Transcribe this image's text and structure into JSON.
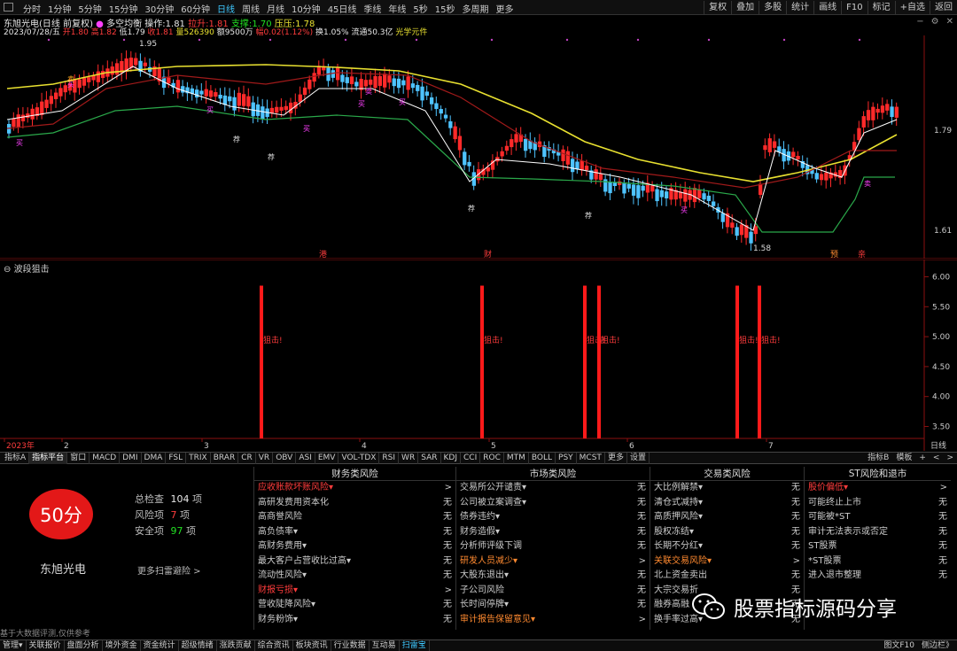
{
  "topbar": {
    "periods": [
      "分时",
      "1分钟",
      "5分钟",
      "15分钟",
      "30分钟",
      "60分钟",
      "日线",
      "周线",
      "月线",
      "10分钟",
      "45日线",
      "季线",
      "年线",
      "5秒",
      "15秒",
      "多周期",
      "更多"
    ],
    "active_period": "日线",
    "tools": [
      "复权",
      "叠加",
      "多股",
      "统计",
      "画线",
      "F10",
      "标记",
      "+自选",
      "返回"
    ]
  },
  "stock": {
    "title": "东旭光电(日线 前复权)",
    "indicator_name": "多空均衡",
    "op_label": "操作:",
    "op_value": "1.81",
    "pull_label": "拉升:",
    "pull_value": "1.81",
    "support_label": "支撑:",
    "support_value": "1.70",
    "pressure_label": "压压:",
    "pressure_value": "1.78",
    "date": "2023/07/28/五",
    "open": "开1.80",
    "high": "高1.82",
    "low": "低1.79",
    "close": "收1.81",
    "volume": "量526390",
    "amount": "额9500万",
    "change": "幅0.02(1.12%)",
    "turnover": "换1.05%",
    "float_cap": "流通50.3亿",
    "concept": "光学元件"
  },
  "main_chart": {
    "price_labels": [
      "1.79",
      "1.61"
    ],
    "high_marker": "1.95",
    "low_marker": "1.58",
    "signal_buy": "买",
    "signal_sell": "卖",
    "signal_recommend": "荐",
    "event_labels": [
      "港",
      "财",
      "预",
      "亲"
    ]
  },
  "chart_data": {
    "type": "bar",
    "title": "波段狙击",
    "ylabel": "",
    "ylim": [
      3.3,
      6.2
    ],
    "y_ticks": [
      "6.00",
      "5.50",
      "5.00",
      "4.50",
      "4.00",
      "3.50"
    ],
    "bar_label": "狙击!",
    "bar_count": 6,
    "bar_value": 6.0,
    "x_ticks": [
      "2023年",
      "2",
      "3",
      "4",
      "5",
      "6",
      "7"
    ],
    "x_period": "日线"
  },
  "indicator_bar": {
    "tabs": [
      "指标A",
      "指标平台",
      "窗口",
      "MACD",
      "DMI",
      "DMA",
      "FSL",
      "TRIX",
      "BRAR",
      "CR",
      "VR",
      "OBV",
      "ASI",
      "EMV",
      "VOL-TDX",
      "RSI",
      "WR",
      "SAR",
      "KDJ",
      "CCI",
      "ROC",
      "MTM",
      "BOLL",
      "PSY",
      "MCST",
      "更多",
      "设置"
    ],
    "active_tab": "指标平台",
    "right": [
      "指标B",
      "模板",
      "+",
      "<",
      ">"
    ]
  },
  "risk": {
    "score": "50分",
    "stock_name": "东旭光电",
    "total_label": "总检查",
    "total_value": "104",
    "total_unit": "项",
    "risk_label": "风险项",
    "risk_value": "7",
    "risk_unit": "项",
    "safe_label": "安全项",
    "safe_value": "97",
    "safe_unit": "项",
    "more_link": "更多扫雷避险 >",
    "columns": [
      {
        "header": "财务类风险",
        "rows": [
          {
            "name": "应收账款坏账风险▾",
            "value": ">",
            "level": "alert"
          },
          {
            "name": "高研发费用资本化",
            "value": "无",
            "level": ""
          },
          {
            "name": "高商誉风险",
            "value": "无",
            "level": ""
          },
          {
            "name": "高负债率▾",
            "value": "无",
            "level": ""
          },
          {
            "name": "高财务费用▾",
            "value": "无",
            "level": ""
          },
          {
            "name": "最大客户占营收比过高▾",
            "value": "无",
            "level": ""
          },
          {
            "name": "流动性风险▾",
            "value": "无",
            "level": ""
          },
          {
            "name": "财报亏损▾",
            "value": ">",
            "level": "alert"
          },
          {
            "name": "营收陡降风险▾",
            "value": "无",
            "level": ""
          },
          {
            "name": "财务粉饰▾",
            "value": "无",
            "level": ""
          }
        ]
      },
      {
        "header": "市场类风险",
        "rows": [
          {
            "name": "交易所公开谴责▾",
            "value": "无",
            "level": ""
          },
          {
            "name": "公司被立案调查▾",
            "value": "无",
            "level": ""
          },
          {
            "name": "债券违约▾",
            "value": "无",
            "level": ""
          },
          {
            "name": "财务造假▾",
            "value": "无",
            "level": ""
          },
          {
            "name": "分析师评级下调",
            "value": "无",
            "level": ""
          },
          {
            "name": "研发人员减少▾",
            "value": ">",
            "level": "alert2"
          },
          {
            "name": "大股东退出▾",
            "value": "无",
            "level": ""
          },
          {
            "name": "子公司风险",
            "value": "无",
            "level": ""
          },
          {
            "name": "长时间停牌▾",
            "value": "无",
            "level": ""
          },
          {
            "name": "审计报告保留意见▾",
            "value": ">",
            "level": "alert2"
          }
        ]
      },
      {
        "header": "交易类风险",
        "rows": [
          {
            "name": "大比例解禁▾",
            "value": "无",
            "level": ""
          },
          {
            "name": "清仓式减持▾",
            "value": "无",
            "level": ""
          },
          {
            "name": "高质押风险▾",
            "value": "无",
            "level": ""
          },
          {
            "name": "股权冻结▾",
            "value": "无",
            "level": ""
          },
          {
            "name": "长期不分红▾",
            "value": "无",
            "level": ""
          },
          {
            "name": "关联交易风险▾",
            "value": ">",
            "level": "alert2"
          },
          {
            "name": "北上资金卖出",
            "value": "无",
            "level": ""
          },
          {
            "name": "大宗交易折",
            "value": "无",
            "level": ""
          },
          {
            "name": "融券高融",
            "value": "无",
            "level": ""
          },
          {
            "name": "换手率过高▾",
            "value": "无",
            "level": ""
          }
        ]
      },
      {
        "header": "ST风险和退市",
        "rows": [
          {
            "name": "股价偏低▾",
            "value": ">",
            "level": "alert"
          },
          {
            "name": "可能终止上市",
            "value": "无",
            "level": ""
          },
          {
            "name": "可能被*ST",
            "value": "无",
            "level": ""
          },
          {
            "name": "审计无法表示或否定",
            "value": "无",
            "level": ""
          },
          {
            "name": "ST股票",
            "value": "无",
            "level": ""
          },
          {
            "name": "*ST股票",
            "value": "无",
            "level": ""
          },
          {
            "name": "进入退市整理",
            "value": "无",
            "level": ""
          }
        ]
      }
    ],
    "disclaimer": "基于大数据评测,仅供参考"
  },
  "bottombar": {
    "tabs": [
      "管理▾",
      "关联报价",
      "盘面分析",
      "境外资金",
      "资金统计",
      "超级情绪",
      "涨跌贡献",
      "综合资讯",
      "板块资讯",
      "行业数据",
      "互动易",
      "扫雷宝"
    ],
    "active_tab": "扫雷宝",
    "right": [
      "图文F10",
      "侧边栏》"
    ]
  },
  "watermark": {
    "text": "股票指标源码分享"
  },
  "colors": {
    "up": "#ff2a2a",
    "down": "#4ec3ff",
    "bg": "#000000",
    "ma_yellow": "#e8e030",
    "ma_dark_red": "#a01a1a",
    "ma_green": "#2aa84a"
  }
}
